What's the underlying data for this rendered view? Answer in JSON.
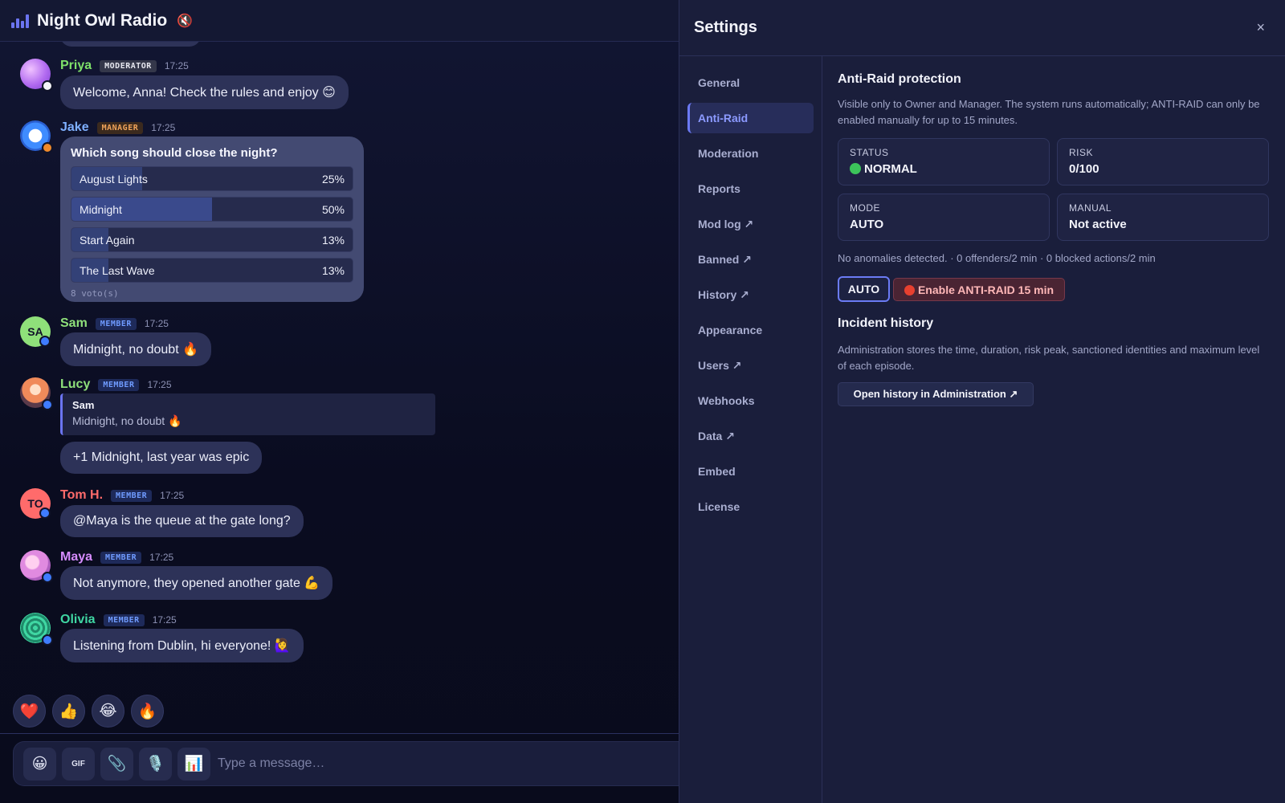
{
  "chat": {
    "title": "Night Owl Radio",
    "mute_icon": "speaker-muted-icon",
    "messages": [
      {
        "author": "Priya",
        "role": "MODERATOR",
        "time": "17:25",
        "text": "Welcome, Anna! Check the rules and enjoy 😊",
        "color": "#7ee06a"
      },
      {
        "author": "Jake",
        "role": "MANAGER",
        "time": "17:25",
        "color": "#7fb0ff"
      },
      {
        "author": "Sam",
        "role": "MEMBER",
        "time": "17:25",
        "initials": "SA",
        "text": "Midnight, no doubt 🔥",
        "color": "#8fe07a"
      },
      {
        "author": "Lucy",
        "role": "MEMBER",
        "time": "17:25",
        "text": "+1 Midnight, last year was epic",
        "quote_author": "Sam",
        "quote_text": "Midnight, no doubt 🔥",
        "color": "#8fe07a"
      },
      {
        "author": "Tom H.",
        "role": "MEMBER",
        "time": "17:25",
        "initials": "TO",
        "text": "@Maya is the queue at the gate long?",
        "color": "#ff6b6b"
      },
      {
        "author": "Maya",
        "role": "MEMBER",
        "time": "17:25",
        "text": "Not anymore, they opened another gate 💪",
        "color": "#d68cff"
      },
      {
        "author": "Olivia",
        "role": "MEMBER",
        "time": "17:25",
        "text": "Listening from Dublin, hi everyone! 🙋‍♀️",
        "color": "#3fd6a2"
      }
    ],
    "poll": {
      "question": "Which song should close the night?",
      "options": [
        {
          "label": "August Lights",
          "pct": "25%",
          "value": 25
        },
        {
          "label": "Midnight",
          "pct": "50%",
          "value": 50
        },
        {
          "label": "Start Again",
          "pct": "13%",
          "value": 13
        },
        {
          "label": "The Last Wave",
          "pct": "13%",
          "value": 13
        }
      ],
      "votes": "8 voto(s)"
    },
    "reactions": [
      "❤️",
      "👍",
      "😂",
      "🔥"
    ],
    "composer": {
      "emoji": "😀",
      "gif": "GIF",
      "attach": "📎",
      "mic": "🎙️",
      "poll": "📊",
      "placeholder": "Type a message…"
    }
  },
  "settings": {
    "title": "Settings",
    "close": "×",
    "nav": [
      "General",
      "Anti-Raid",
      "Moderation",
      "Reports",
      "Mod log ↗",
      "Banned ↗",
      "History ↗",
      "Appearance",
      "Users ↗",
      "Webhooks",
      "Data ↗",
      "Embed",
      "License"
    ],
    "active_nav": "Anti-Raid",
    "antiraid": {
      "title": "Anti-Raid protection",
      "description": "Visible only to Owner and Manager. The system runs automatically; ANTI-RAID can only be enabled manually for up to 15 minutes.",
      "status_label": "STATUS",
      "status_value": "NORMAL",
      "risk_label": "RISK",
      "risk_value": "0/100",
      "mode_label": "MODE",
      "mode_value": "AUTO",
      "manual_label": "MANUAL",
      "manual_value": "Not active",
      "summary": "No anomalies detected. · 0 offenders/2 min · 0 blocked actions/2 min",
      "auto_button": "AUTO",
      "enable_button": "Enable ANTI-RAID 15 min",
      "status_color": "#3cc45a",
      "alert_color": "#e8402f"
    },
    "incident": {
      "title": "Incident history",
      "description": "Administration stores the time, duration, risk peak, sanctioned identities and maximum level of each episode.",
      "button": "Open history in Administration ↗"
    }
  }
}
